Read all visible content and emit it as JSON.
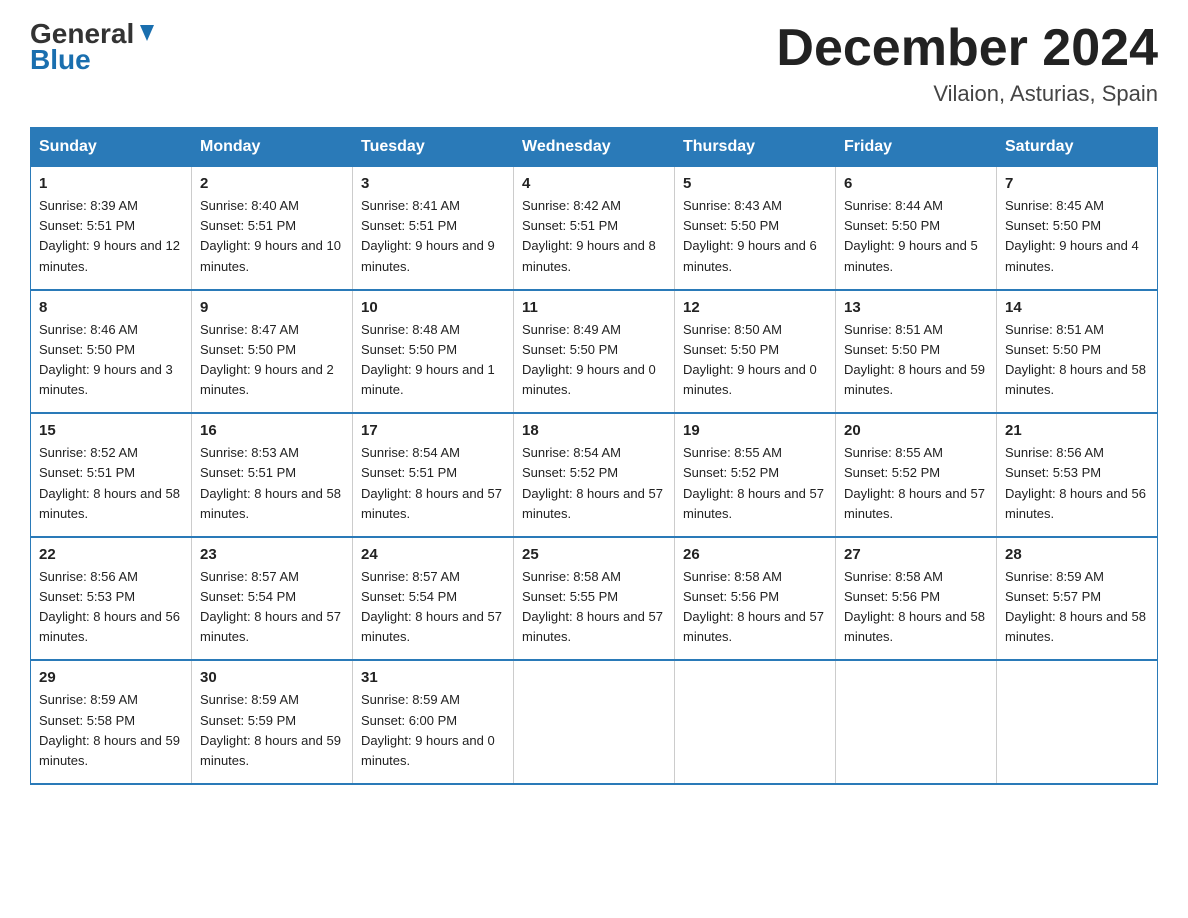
{
  "header": {
    "logo_general": "General",
    "logo_blue": "Blue",
    "month_title": "December 2024",
    "location": "Vilaion, Asturias, Spain"
  },
  "weekdays": [
    "Sunday",
    "Monday",
    "Tuesday",
    "Wednesday",
    "Thursday",
    "Friday",
    "Saturday"
  ],
  "weeks": [
    [
      {
        "day": "1",
        "sunrise": "8:39 AM",
        "sunset": "5:51 PM",
        "daylight": "9 hours and 12 minutes."
      },
      {
        "day": "2",
        "sunrise": "8:40 AM",
        "sunset": "5:51 PM",
        "daylight": "9 hours and 10 minutes."
      },
      {
        "day": "3",
        "sunrise": "8:41 AM",
        "sunset": "5:51 PM",
        "daylight": "9 hours and 9 minutes."
      },
      {
        "day": "4",
        "sunrise": "8:42 AM",
        "sunset": "5:51 PM",
        "daylight": "9 hours and 8 minutes."
      },
      {
        "day": "5",
        "sunrise": "8:43 AM",
        "sunset": "5:50 PM",
        "daylight": "9 hours and 6 minutes."
      },
      {
        "day": "6",
        "sunrise": "8:44 AM",
        "sunset": "5:50 PM",
        "daylight": "9 hours and 5 minutes."
      },
      {
        "day": "7",
        "sunrise": "8:45 AM",
        "sunset": "5:50 PM",
        "daylight": "9 hours and 4 minutes."
      }
    ],
    [
      {
        "day": "8",
        "sunrise": "8:46 AM",
        "sunset": "5:50 PM",
        "daylight": "9 hours and 3 minutes."
      },
      {
        "day": "9",
        "sunrise": "8:47 AM",
        "sunset": "5:50 PM",
        "daylight": "9 hours and 2 minutes."
      },
      {
        "day": "10",
        "sunrise": "8:48 AM",
        "sunset": "5:50 PM",
        "daylight": "9 hours and 1 minute."
      },
      {
        "day": "11",
        "sunrise": "8:49 AM",
        "sunset": "5:50 PM",
        "daylight": "9 hours and 0 minutes."
      },
      {
        "day": "12",
        "sunrise": "8:50 AM",
        "sunset": "5:50 PM",
        "daylight": "9 hours and 0 minutes."
      },
      {
        "day": "13",
        "sunrise": "8:51 AM",
        "sunset": "5:50 PM",
        "daylight": "8 hours and 59 minutes."
      },
      {
        "day": "14",
        "sunrise": "8:51 AM",
        "sunset": "5:50 PM",
        "daylight": "8 hours and 58 minutes."
      }
    ],
    [
      {
        "day": "15",
        "sunrise": "8:52 AM",
        "sunset": "5:51 PM",
        "daylight": "8 hours and 58 minutes."
      },
      {
        "day": "16",
        "sunrise": "8:53 AM",
        "sunset": "5:51 PM",
        "daylight": "8 hours and 58 minutes."
      },
      {
        "day": "17",
        "sunrise": "8:54 AM",
        "sunset": "5:51 PM",
        "daylight": "8 hours and 57 minutes."
      },
      {
        "day": "18",
        "sunrise": "8:54 AM",
        "sunset": "5:52 PM",
        "daylight": "8 hours and 57 minutes."
      },
      {
        "day": "19",
        "sunrise": "8:55 AM",
        "sunset": "5:52 PM",
        "daylight": "8 hours and 57 minutes."
      },
      {
        "day": "20",
        "sunrise": "8:55 AM",
        "sunset": "5:52 PM",
        "daylight": "8 hours and 57 minutes."
      },
      {
        "day": "21",
        "sunrise": "8:56 AM",
        "sunset": "5:53 PM",
        "daylight": "8 hours and 56 minutes."
      }
    ],
    [
      {
        "day": "22",
        "sunrise": "8:56 AM",
        "sunset": "5:53 PM",
        "daylight": "8 hours and 56 minutes."
      },
      {
        "day": "23",
        "sunrise": "8:57 AM",
        "sunset": "5:54 PM",
        "daylight": "8 hours and 57 minutes."
      },
      {
        "day": "24",
        "sunrise": "8:57 AM",
        "sunset": "5:54 PM",
        "daylight": "8 hours and 57 minutes."
      },
      {
        "day": "25",
        "sunrise": "8:58 AM",
        "sunset": "5:55 PM",
        "daylight": "8 hours and 57 minutes."
      },
      {
        "day": "26",
        "sunrise": "8:58 AM",
        "sunset": "5:56 PM",
        "daylight": "8 hours and 57 minutes."
      },
      {
        "day": "27",
        "sunrise": "8:58 AM",
        "sunset": "5:56 PM",
        "daylight": "8 hours and 58 minutes."
      },
      {
        "day": "28",
        "sunrise": "8:59 AM",
        "sunset": "5:57 PM",
        "daylight": "8 hours and 58 minutes."
      }
    ],
    [
      {
        "day": "29",
        "sunrise": "8:59 AM",
        "sunset": "5:58 PM",
        "daylight": "8 hours and 59 minutes."
      },
      {
        "day": "30",
        "sunrise": "8:59 AM",
        "sunset": "5:59 PM",
        "daylight": "8 hours and 59 minutes."
      },
      {
        "day": "31",
        "sunrise": "8:59 AM",
        "sunset": "6:00 PM",
        "daylight": "9 hours and 0 minutes."
      },
      null,
      null,
      null,
      null
    ]
  ]
}
